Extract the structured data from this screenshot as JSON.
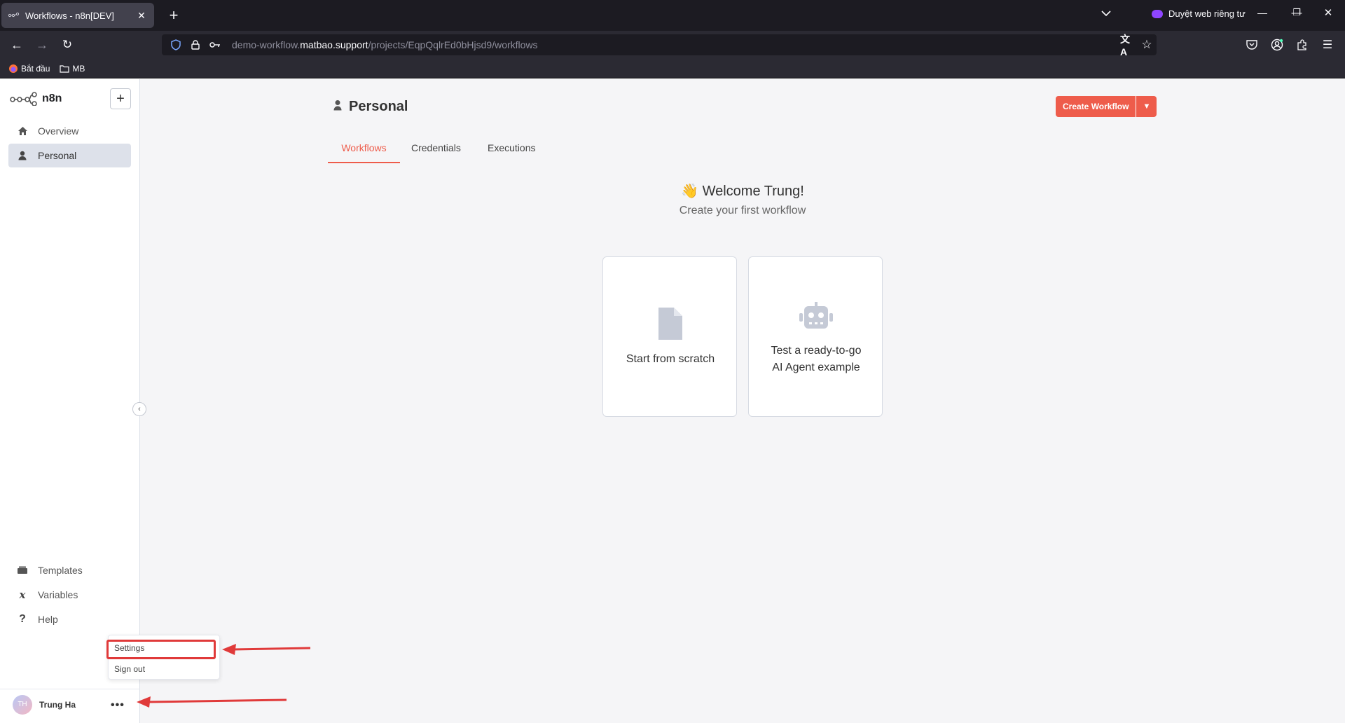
{
  "browser": {
    "tab_title": "Workflows - n8n[DEV]",
    "private_label": "Duyệt web riêng tư",
    "url_prefix": "demo-workflow.",
    "url_domain": "matbao.support",
    "url_path": "/projects/EqpQqlrEd0bHjsd9/workflows",
    "bookmarks": [
      {
        "label": "Bắt đầu",
        "icon": "firefox-icon"
      },
      {
        "label": "MB",
        "icon": "folder-icon"
      }
    ]
  },
  "sidebar": {
    "logo_text": "n8n",
    "add_button": "+",
    "top_items": [
      {
        "label": "Overview",
        "icon": "home-icon"
      },
      {
        "label": "Personal",
        "icon": "user-icon"
      }
    ],
    "bottom_items": [
      {
        "label": "Templates",
        "icon": "box-icon"
      },
      {
        "label": "Variables",
        "icon": "variables-icon"
      },
      {
        "label": "Help",
        "icon": "question-icon"
      }
    ],
    "user": {
      "initials": "TH",
      "name": "Trung Ha",
      "more": "•••"
    },
    "user_menu": [
      "Settings",
      "Sign out"
    ]
  },
  "main": {
    "title": "Personal",
    "create_button": "Create Workflow",
    "tabs": [
      "Workflows",
      "Credentials",
      "Executions"
    ],
    "active_tab": "Workflows",
    "welcome_title": "👋 Welcome Trung!",
    "welcome_subtitle": "Create your first workflow",
    "cards": [
      {
        "line1": "Start from scratch",
        "line2": "",
        "icon": "file-icon"
      },
      {
        "line1": "Test a ready-to-go",
        "line2": "AI Agent example",
        "icon": "robot-icon"
      }
    ]
  },
  "colors": {
    "accent": "#ee5c4b",
    "annotation": "#e03a3a"
  }
}
